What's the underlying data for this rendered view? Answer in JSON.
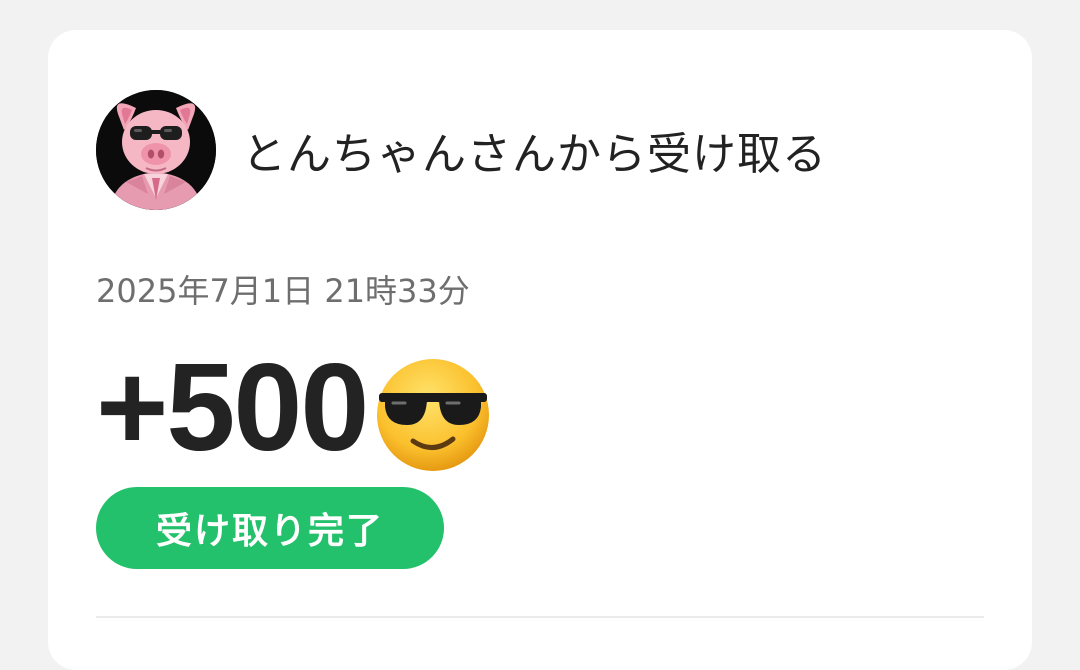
{
  "transaction": {
    "sender_title": "とんちゃんさんから受け取る",
    "avatar_icon": "pig-in-sunglasses-avatar",
    "timestamp": "2025年7月1日 21時33分",
    "amount": "+500",
    "amount_emoji_icon": "smiling-face-with-sunglasses-icon",
    "status_label": "受け取り完了"
  },
  "colors": {
    "background": "#f2f2f2",
    "card": "#ffffff",
    "status_green": "#23c16b",
    "text_primary": "#222222",
    "text_secondary": "#6e6e6e"
  }
}
